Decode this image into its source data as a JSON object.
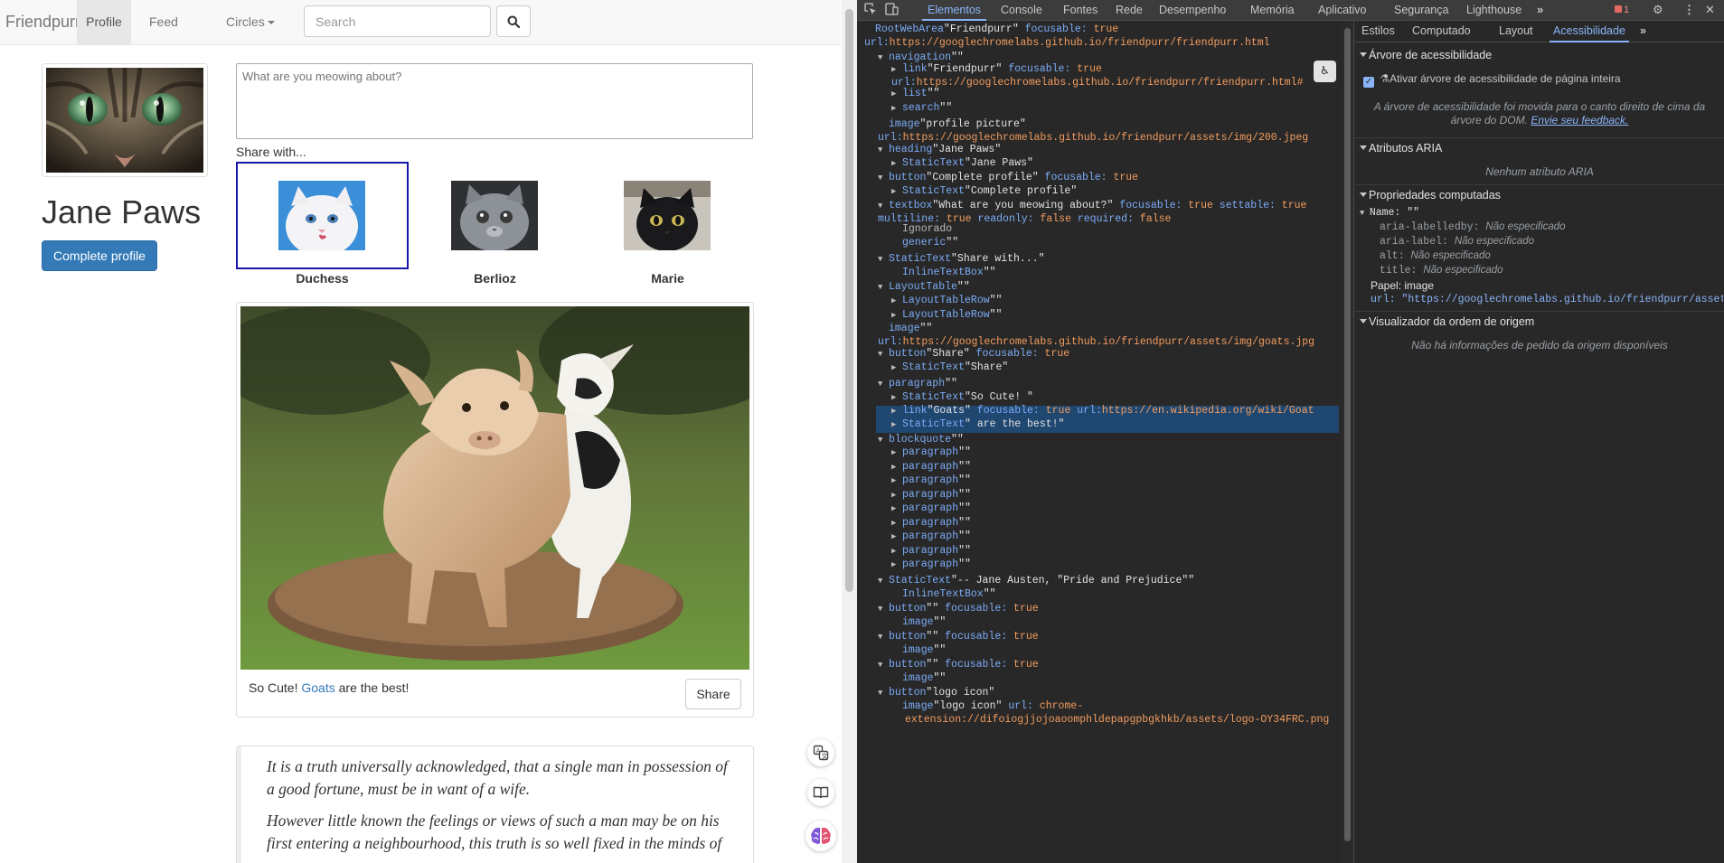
{
  "page": {
    "navbar": {
      "brand": "Friendpurr",
      "items": [
        {
          "label": "Profile",
          "active": true
        },
        {
          "label": "Feed",
          "active": false
        },
        {
          "label": "Circles",
          "active": false
        }
      ],
      "search_placeholder": "Search",
      "search_icon": "search-icon"
    },
    "profile": {
      "name": "Jane Paws",
      "complete_label": "Complete profile"
    },
    "composer": {
      "placeholder": "What are you meowing about?",
      "share_with": "Share with..."
    },
    "friends": [
      {
        "name": "Duchess",
        "selected": true
      },
      {
        "name": "Berlioz",
        "selected": false
      },
      {
        "name": "Marie",
        "selected": false
      }
    ],
    "post": {
      "caption_before": "So Cute! ",
      "caption_link": "Goats",
      "caption_after": " are the best!",
      "share_label": "Share"
    },
    "quote": {
      "paragraphs": [
        "It is a truth universally acknowledged, that a single man in possession of a good fortune, must be in want of a wife.",
        "However little known the feelings or views of such a man may be on his first entering a neighbourhood, this truth is so well fixed in the minds of"
      ]
    }
  },
  "devtools": {
    "tabs": [
      "Elementos",
      "Console",
      "Fontes",
      "Rede",
      "Desempenho",
      "Memória",
      "Aplicativo",
      "Segurança",
      "Lighthouse"
    ],
    "active_tab": "Elementos",
    "error_count": "1",
    "tree": [
      {
        "tri": "",
        "role": "RootWebArea",
        "name": "\"Friendpurr\"",
        "props": " focusable: true",
        "url": "https://googlechromelabs.github.io/friendpurr/friendpurr.html"
      },
      {
        "tri": "▼",
        "role": "navigation",
        "name": "\"\""
      },
      {
        "tri": "▶",
        "role": "link",
        "name": "\"Friendpurr\"",
        "props": " focusable: true",
        "url": "https://googlechromelabs.github.io/friendpurr/friendpurr.html#"
      },
      {
        "tri": "▶",
        "role": "list",
        "name": "\"\""
      },
      {
        "tri": "▶",
        "role": "search",
        "name": "\"\""
      },
      {
        "tri": "",
        "role": "image",
        "name": "\"profile picture\"",
        "url": "https://googlechromelabs.github.io/friendpurr/assets/img/200.jpeg"
      },
      {
        "tri": "▼",
        "role": "heading",
        "name": "\"Jane Paws\""
      },
      {
        "tri": "▶",
        "role": "StaticText",
        "name": "\"Jane Paws\""
      },
      {
        "tri": "▼",
        "role": "button",
        "name": "\"Complete profile\"",
        "props": " focusable: true"
      },
      {
        "tri": "▶",
        "role": "StaticText",
        "name": "\"Complete profile\""
      },
      {
        "tri": "▼",
        "role": "textbox",
        "name": "\"What are you meowing about?\"",
        "props": " focusable: true settable: true",
        "props2": "multiline: true readonly: false required: false"
      },
      {
        "tri": "",
        "role": "Ignorado",
        "name": ""
      },
      {
        "tri": "",
        "role": "generic",
        "name": "\"\""
      },
      {
        "tri": "▼",
        "role": "StaticText",
        "name": "\"Share with...\""
      },
      {
        "tri": "",
        "role": "InlineTextBox",
        "name": "\"\""
      },
      {
        "tri": "▼",
        "role": "LayoutTable",
        "name": "\"\""
      },
      {
        "tri": "▶",
        "role": "LayoutTableRow",
        "name": "\"\""
      },
      {
        "tri": "▶",
        "role": "LayoutTableRow",
        "name": "\"\""
      },
      {
        "tri": "",
        "role": "image",
        "name": "\"\"",
        "url": "https://googlechromelabs.github.io/friendpurr/assets/img/goats.jpg"
      },
      {
        "tri": "▼",
        "role": "button",
        "name": "\"Share\"",
        "props": " focusable: true"
      },
      {
        "tri": "▶",
        "role": "StaticText",
        "name": "\"Share\""
      },
      {
        "tri": "▼",
        "role": "paragraph",
        "name": "\"\""
      },
      {
        "tri": "▶",
        "role": "StaticText",
        "name": "\"So Cute! \""
      },
      {
        "tri": "▶",
        "role": "link",
        "name": "\"Goats\"",
        "props": " focusable: true url:",
        "url_inline": "https://en.wikipedia.org/wiki/Goat"
      },
      {
        "tri": "▶",
        "role": "StaticText",
        "name": "\" are the best!\""
      },
      {
        "tri": "▼",
        "role": "blockquote",
        "name": "\"\""
      },
      {
        "tri": "▶",
        "role": "paragraph",
        "name": "\"\""
      },
      {
        "tri": "▶",
        "role": "paragraph",
        "name": "\"\""
      },
      {
        "tri": "▶",
        "role": "paragraph",
        "name": "\"\""
      },
      {
        "tri": "▶",
        "role": "paragraph",
        "name": "\"\""
      },
      {
        "tri": "▶",
        "role": "paragraph",
        "name": "\"\""
      },
      {
        "tri": "▶",
        "role": "paragraph",
        "name": "\"\""
      },
      {
        "tri": "▶",
        "role": "paragraph",
        "name": "\"\""
      },
      {
        "tri": "▶",
        "role": "paragraph",
        "name": "\"\""
      },
      {
        "tri": "▶",
        "role": "paragraph",
        "name": "\"\""
      },
      {
        "tri": "▼",
        "role": "StaticText",
        "name": "\"-- Jane Austen, \"Pride and Prejudice\"\""
      },
      {
        "tri": "",
        "role": "InlineTextBox",
        "name": "\"\""
      },
      {
        "tri": "▼",
        "role": "button",
        "name": "\"\"",
        "props": " focusable: true"
      },
      {
        "tri": "",
        "role": "image",
        "name": "\"\""
      },
      {
        "tri": "▼",
        "role": "button",
        "name": "\"\"",
        "props": " focusable: true"
      },
      {
        "tri": "",
        "role": "image",
        "name": "\"\""
      },
      {
        "tri": "▼",
        "role": "button",
        "name": "\"\"",
        "props": " focusable: true"
      },
      {
        "tri": "",
        "role": "image",
        "name": "\"\""
      },
      {
        "tri": "▼",
        "role": "button",
        "name": "\"logo icon\""
      },
      {
        "tri": "",
        "role": "image",
        "name": "\"logo icon\"",
        "props": " url: chrome-",
        "url": "extension://difoiogjjojoaoomphldepapgpbgkhkb/assets/logo-OY34FRC.png"
      }
    ],
    "side_tabs": [
      "Estilos",
      "Computado",
      "Layout",
      "Acessibilidade"
    ],
    "side_active": "Acessibilidade",
    "sections": {
      "tree_title": "Árvore de acessibilidade",
      "enable_full": "Ativar árvore de acessibilidade de página inteira",
      "moved_note": "A árvore de acessibilidade foi movida para o canto direito de cima da árvore do DOM.",
      "feedback_link": "Envie seu feedback.",
      "aria_title": "Atributos ARIA",
      "aria_empty": "Nenhum atributo ARIA",
      "computed_title": "Propriedades computadas",
      "name_label": "Name: \"\"",
      "name_sources": [
        {
          "key": "aria-labelledby",
          "val": "Não especificado"
        },
        {
          "key": "aria-label",
          "val": "Não especificado"
        },
        {
          "key": "alt",
          "val": "Não especificado"
        },
        {
          "key": "title",
          "val": "Não especificado"
        }
      ],
      "role_label": "Papel: image",
      "url_label": "url: \"https://googlechromelabs.github.io/friendpurr/assets...",
      "source_order_title": "Visualizador da ordem de origem",
      "source_order_empty": "Não há informações de pedido da origem disponíveis"
    }
  }
}
